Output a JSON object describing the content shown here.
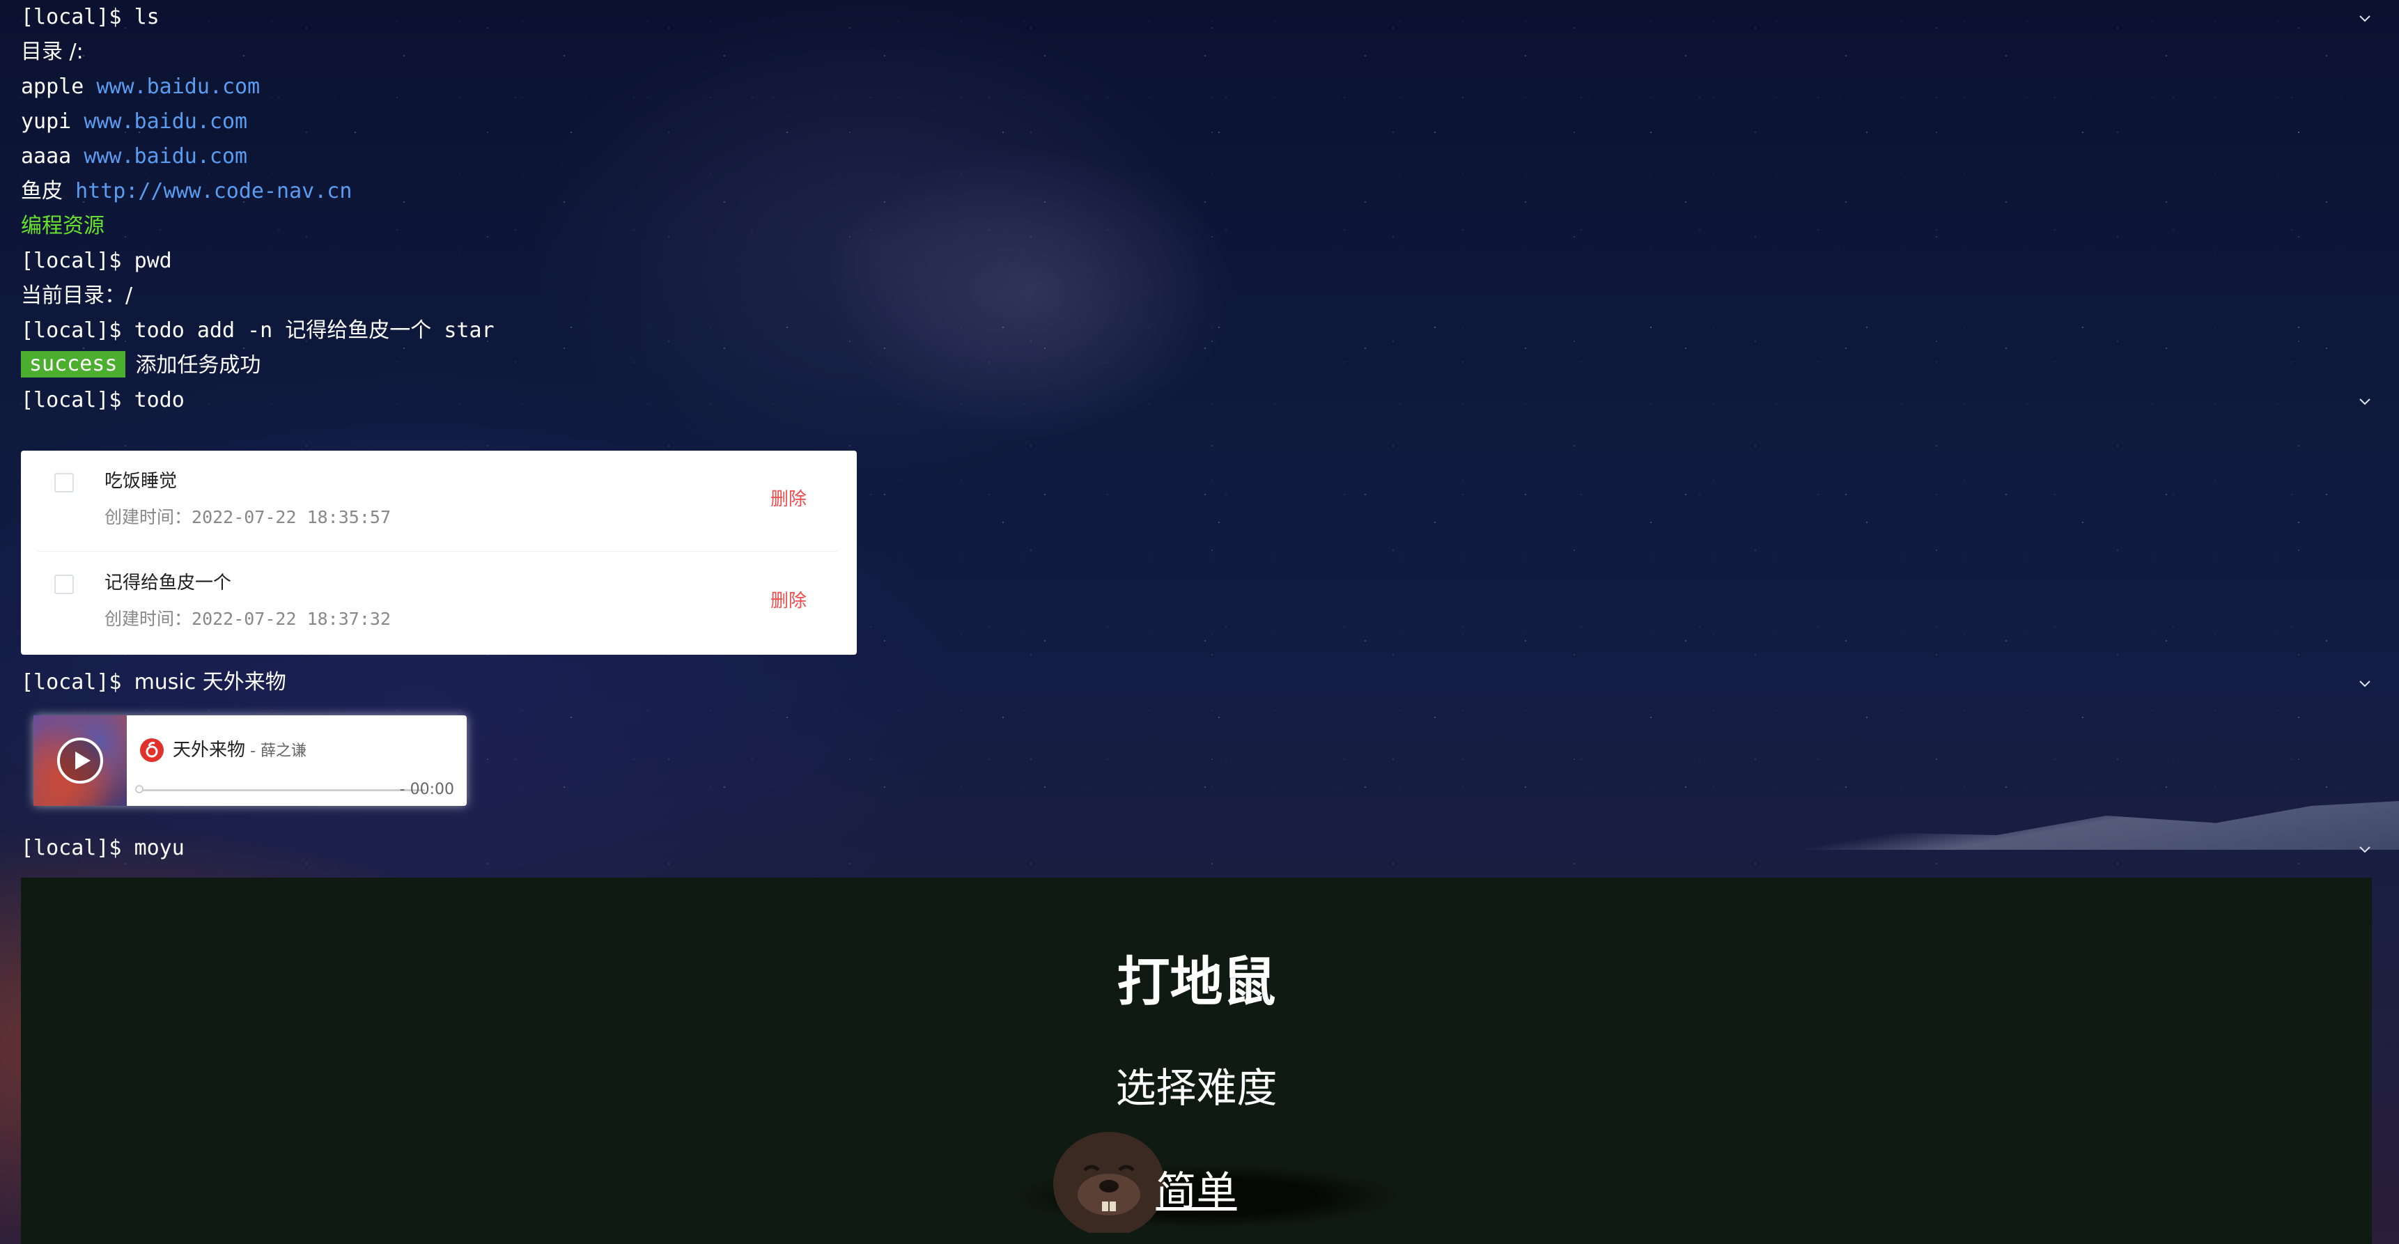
{
  "prompt": "[local]$ ",
  "ls": {
    "command": "ls",
    "dir_label": "目录 /:",
    "entries": [
      {
        "name": "apple",
        "url": "www.baidu.com"
      },
      {
        "name": "yupi",
        "url": "www.baidu.com"
      },
      {
        "name": "aaaa",
        "url": "www.baidu.com"
      },
      {
        "name": "鱼皮",
        "url": "http://www.code-nav.cn"
      }
    ],
    "folder": "编程资源"
  },
  "pwd": {
    "command": "pwd",
    "output": "当前目录：/"
  },
  "todo_add": {
    "command": "todo add -n 记得给鱼皮一个 star",
    "badge": "success",
    "message": "添加任务成功"
  },
  "todo": {
    "command": "todo",
    "items": [
      {
        "title": "吃饭睡觉",
        "time_label": "创建时间：",
        "time": "2022-07-22 18:35:57",
        "delete_label": "删除",
        "done": false
      },
      {
        "title": "记得给鱼皮一个",
        "time_label": "创建时间：",
        "time": "2022-07-22 18:37:32",
        "delete_label": "删除",
        "done": false
      }
    ]
  },
  "music": {
    "command": "music 天外来物",
    "title": "天外来物",
    "artist": " - 薛之谦",
    "time": "- 00:00",
    "progress": 0
  },
  "moyu": {
    "command": "moyu",
    "game_title": "打地鼠",
    "subtitle": "选择难度",
    "option": "简单"
  },
  "icons": {
    "collapse": "chevron-down-icon",
    "play": "play-icon",
    "netease": "netease-music-icon",
    "mole": "mole-icon"
  },
  "colors": {
    "link": "#5a9cf0",
    "folder": "#66e22c",
    "success_badge": "#4cae2e",
    "delete": "#f14c4c",
    "game_bg": "#0f1a12"
  }
}
